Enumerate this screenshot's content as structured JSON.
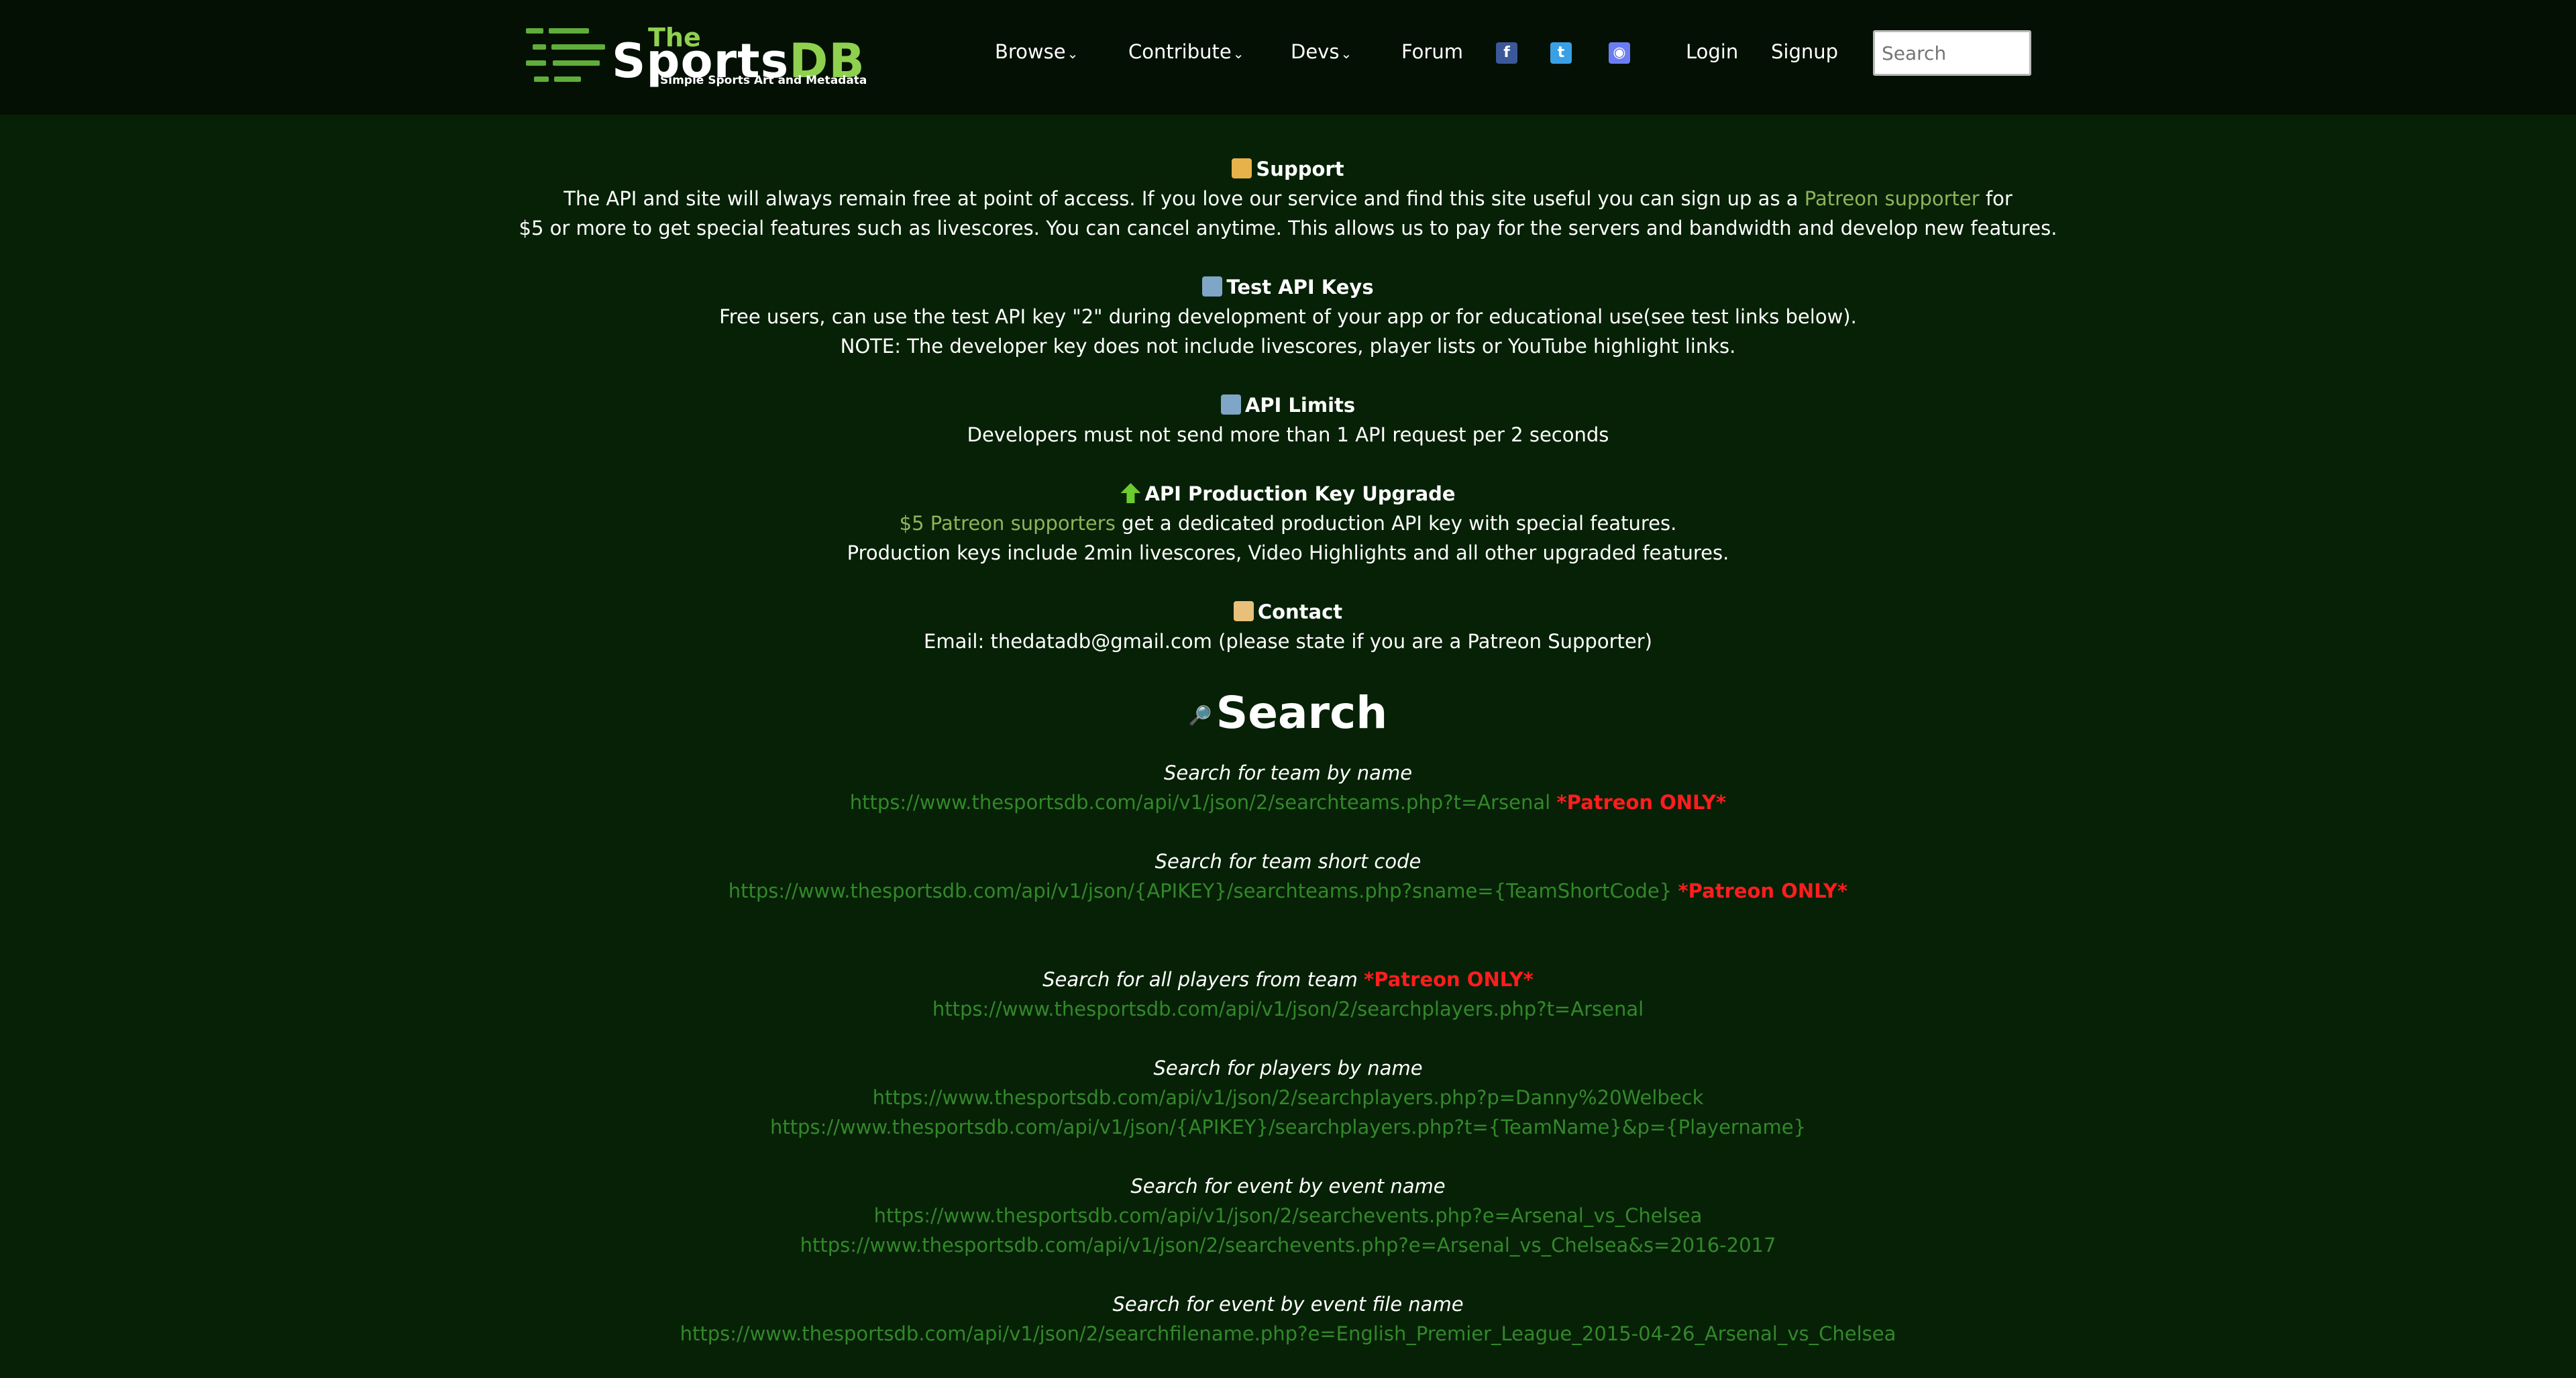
{
  "nav": {
    "logo_the": "The",
    "logo_sports": "Sports",
    "logo_db": "DB",
    "logo_tagline": "Simple Sports Art and Metadata",
    "browse": "Browse",
    "contribute": "Contribute",
    "devs": "Devs",
    "forum": "Forum",
    "login": "Login",
    "signup": "Signup",
    "search_placeholder": "Search"
  },
  "support": {
    "title": "Support",
    "line1_pre": "The API and site will always remain free at point of access. If you love our service and find this site useful you can sign up as a ",
    "line1_link": "Patreon supporter",
    "line1_post": " for",
    "line2": "$5 or more to get special features such as livescores. You can cancel anytime. This allows us to pay for the servers and bandwidth and develop new features."
  },
  "test_keys": {
    "title": "Test API Keys",
    "line1": "Free users, can use the test API key \"2\" during development of your app or for educational use(see test links below).",
    "line2": "NOTE: The developer key does not include livescores, player lists or YouTube highlight links."
  },
  "limits": {
    "title": "API Limits",
    "line1": "Developers must not send more than 1 API request per 2 seconds"
  },
  "upgrade": {
    "title": "API Production Key Upgrade",
    "line1_link": "$5 Patreon supporters",
    "line1_post": " get a dedicated production API key with special features.",
    "line2": "Production keys include 2min livescores, Video Highlights and all other upgraded features."
  },
  "contact": {
    "title": "Contact",
    "line1": "Email: thedatadb@gmail.com (please state if you are a Patreon Supporter)"
  },
  "search": {
    "title": "Search",
    "patreon_only": "*Patreon ONLY*",
    "q1_title": "Search for team by name",
    "q1_link": "https://www.thesportsdb.com/api/v1/json/2/searchteams.php?t=Arsenal",
    "q2_title": "Search for team short code",
    "q2_link": "https://www.thesportsdb.com/api/v1/json/{APIKEY}/searchteams.php?sname={TeamShortCode}",
    "q3_title": "Search for all players from team",
    "q3_link": "https://www.thesportsdb.com/api/v1/json/2/searchplayers.php?t=Arsenal",
    "q4_title": "Search for players by name",
    "q4_link1": "https://www.thesportsdb.com/api/v1/json/2/searchplayers.php?p=Danny%20Welbeck",
    "q4_link2": "https://www.thesportsdb.com/api/v1/json/{APIKEY}/searchplayers.php?t={TeamName}&p={Playername}",
    "q5_title": "Search for event by event name",
    "q5_link1": "https://www.thesportsdb.com/api/v1/json/2/searchevents.php?e=Arsenal_vs_Chelsea",
    "q5_link2": "https://www.thesportsdb.com/api/v1/json/2/searchevents.php?e=Arsenal_vs_Chelsea&s=2016-2017",
    "q6_title": "Search for event by event file name",
    "q6_link": "https://www.thesportsdb.com/api/v1/json/2/searchfilename.php?e=English_Premier_League_2015-04-26_Arsenal_vs_Chelsea"
  },
  "colors": {
    "background": "#062106",
    "navbar": "#031003",
    "link": "#8fb45a",
    "api_link": "#33882a",
    "patreon_red": "#ff1d1d"
  },
  "icons": {
    "support": "thumbs-up-icon",
    "test_keys": "key-icon",
    "limits": "gauge-icon",
    "upgrade": "up-arrow-icon",
    "contact": "envelope-icon",
    "search": "magnifier-icon",
    "facebook": "facebook-icon",
    "twitter": "twitter-icon",
    "discord": "discord-icon"
  }
}
